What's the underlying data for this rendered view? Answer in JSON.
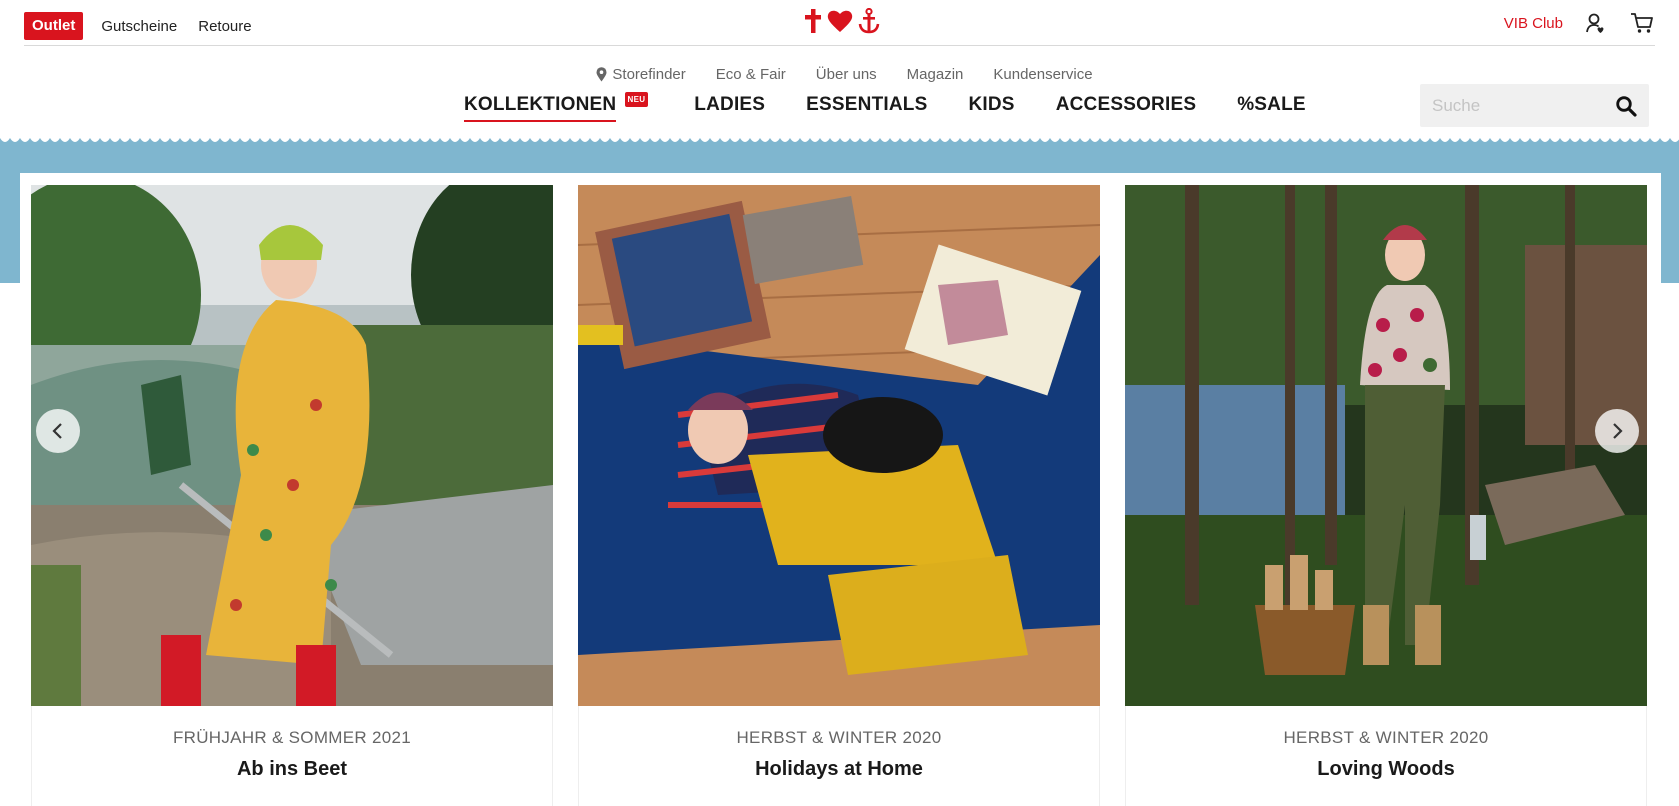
{
  "topbar": {
    "outlet_label": "Outlet",
    "links": [
      "Gutscheine",
      "Retoure"
    ],
    "vib_label": "VIB Club"
  },
  "logo": {
    "icons": [
      "cross-icon",
      "heart-icon",
      "anchor-icon"
    ]
  },
  "subnav": {
    "items": [
      {
        "label": "Storefinder",
        "icon": "location-pin-icon"
      },
      {
        "label": "Eco & Fair"
      },
      {
        "label": "Über uns"
      },
      {
        "label": "Magazin"
      },
      {
        "label": "Kundenservice"
      }
    ]
  },
  "mainnav": {
    "items": [
      "KOLLEKTIONEN",
      "LADIES",
      "ESSENTIALS",
      "KIDS",
      "ACCESSORIES",
      "%SALE"
    ],
    "badge": "NEU"
  },
  "search": {
    "placeholder": "Suche"
  },
  "colors": {
    "brand_red": "#d9141e",
    "band_blue": "#7fb6cf",
    "text_dark": "#1a1a1a",
    "text_muted": "#666666"
  },
  "cards": [
    {
      "kicker": "FRÜHJAHR & SOMMER 2021",
      "title": "Ab ins Beet"
    },
    {
      "kicker": "HERBST & WINTER 2020",
      "title": "Holidays at Home"
    },
    {
      "kicker": "HERBST & WINTER 2020",
      "title": "Loving Woods"
    }
  ],
  "carousel": {
    "prev_icon": "chevron-left-icon",
    "next_icon": "chevron-right-icon"
  }
}
